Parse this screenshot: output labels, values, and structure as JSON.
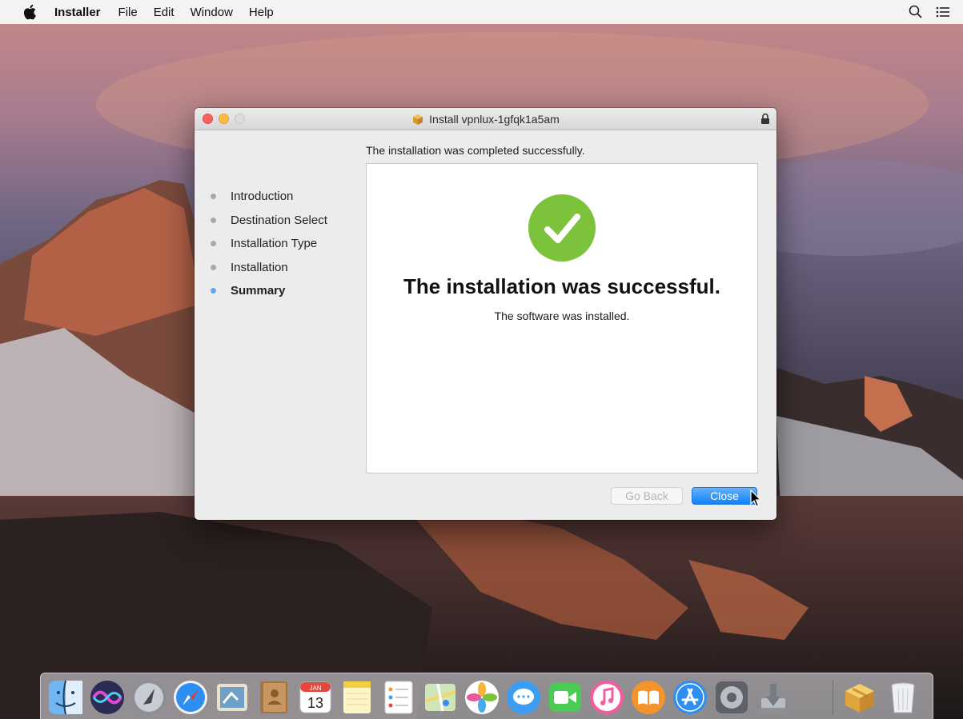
{
  "menubar": {
    "app_name": "Installer",
    "items": [
      "File",
      "Edit",
      "Window",
      "Help"
    ],
    "icons": [
      "apple-icon",
      "spotlight-search-icon",
      "notification-center-icon"
    ]
  },
  "window": {
    "title": "Install vpnlux-1gfqk1a5am",
    "status_heading": "The installation was completed successfully.",
    "steps": [
      {
        "label": "Introduction",
        "active": false
      },
      {
        "label": "Destination Select",
        "active": false
      },
      {
        "label": "Installation Type",
        "active": false
      },
      {
        "label": "Installation",
        "active": false
      },
      {
        "label": "Summary",
        "active": true
      }
    ],
    "success_title": "The installation was successful.",
    "success_subtitle": "The software was installed.",
    "buttons": {
      "go_back": "Go Back",
      "close": "Close"
    }
  },
  "colors": {
    "success_green": "#7cc33b",
    "primary_blue": "#0d81fb",
    "active_step_dot": "#5fa6ea",
    "close_light": "#fc615d",
    "minimize_light": "#fdbc40"
  },
  "dock": {
    "apps": [
      "finder-icon",
      "siri-icon",
      "launchpad-icon",
      "safari-icon",
      "mail-icon",
      "contacts-icon",
      "calendar-icon",
      "notes-icon",
      "reminders-icon",
      "maps-icon",
      "photos-icon",
      "messages-icon",
      "facetime-icon",
      "itunes-icon",
      "ibooks-icon",
      "app-store-icon",
      "system-preferences-icon",
      "installer-icon",
      "package-icon",
      "trash-icon"
    ],
    "calendar": {
      "month": "JAN",
      "day": "13"
    }
  }
}
